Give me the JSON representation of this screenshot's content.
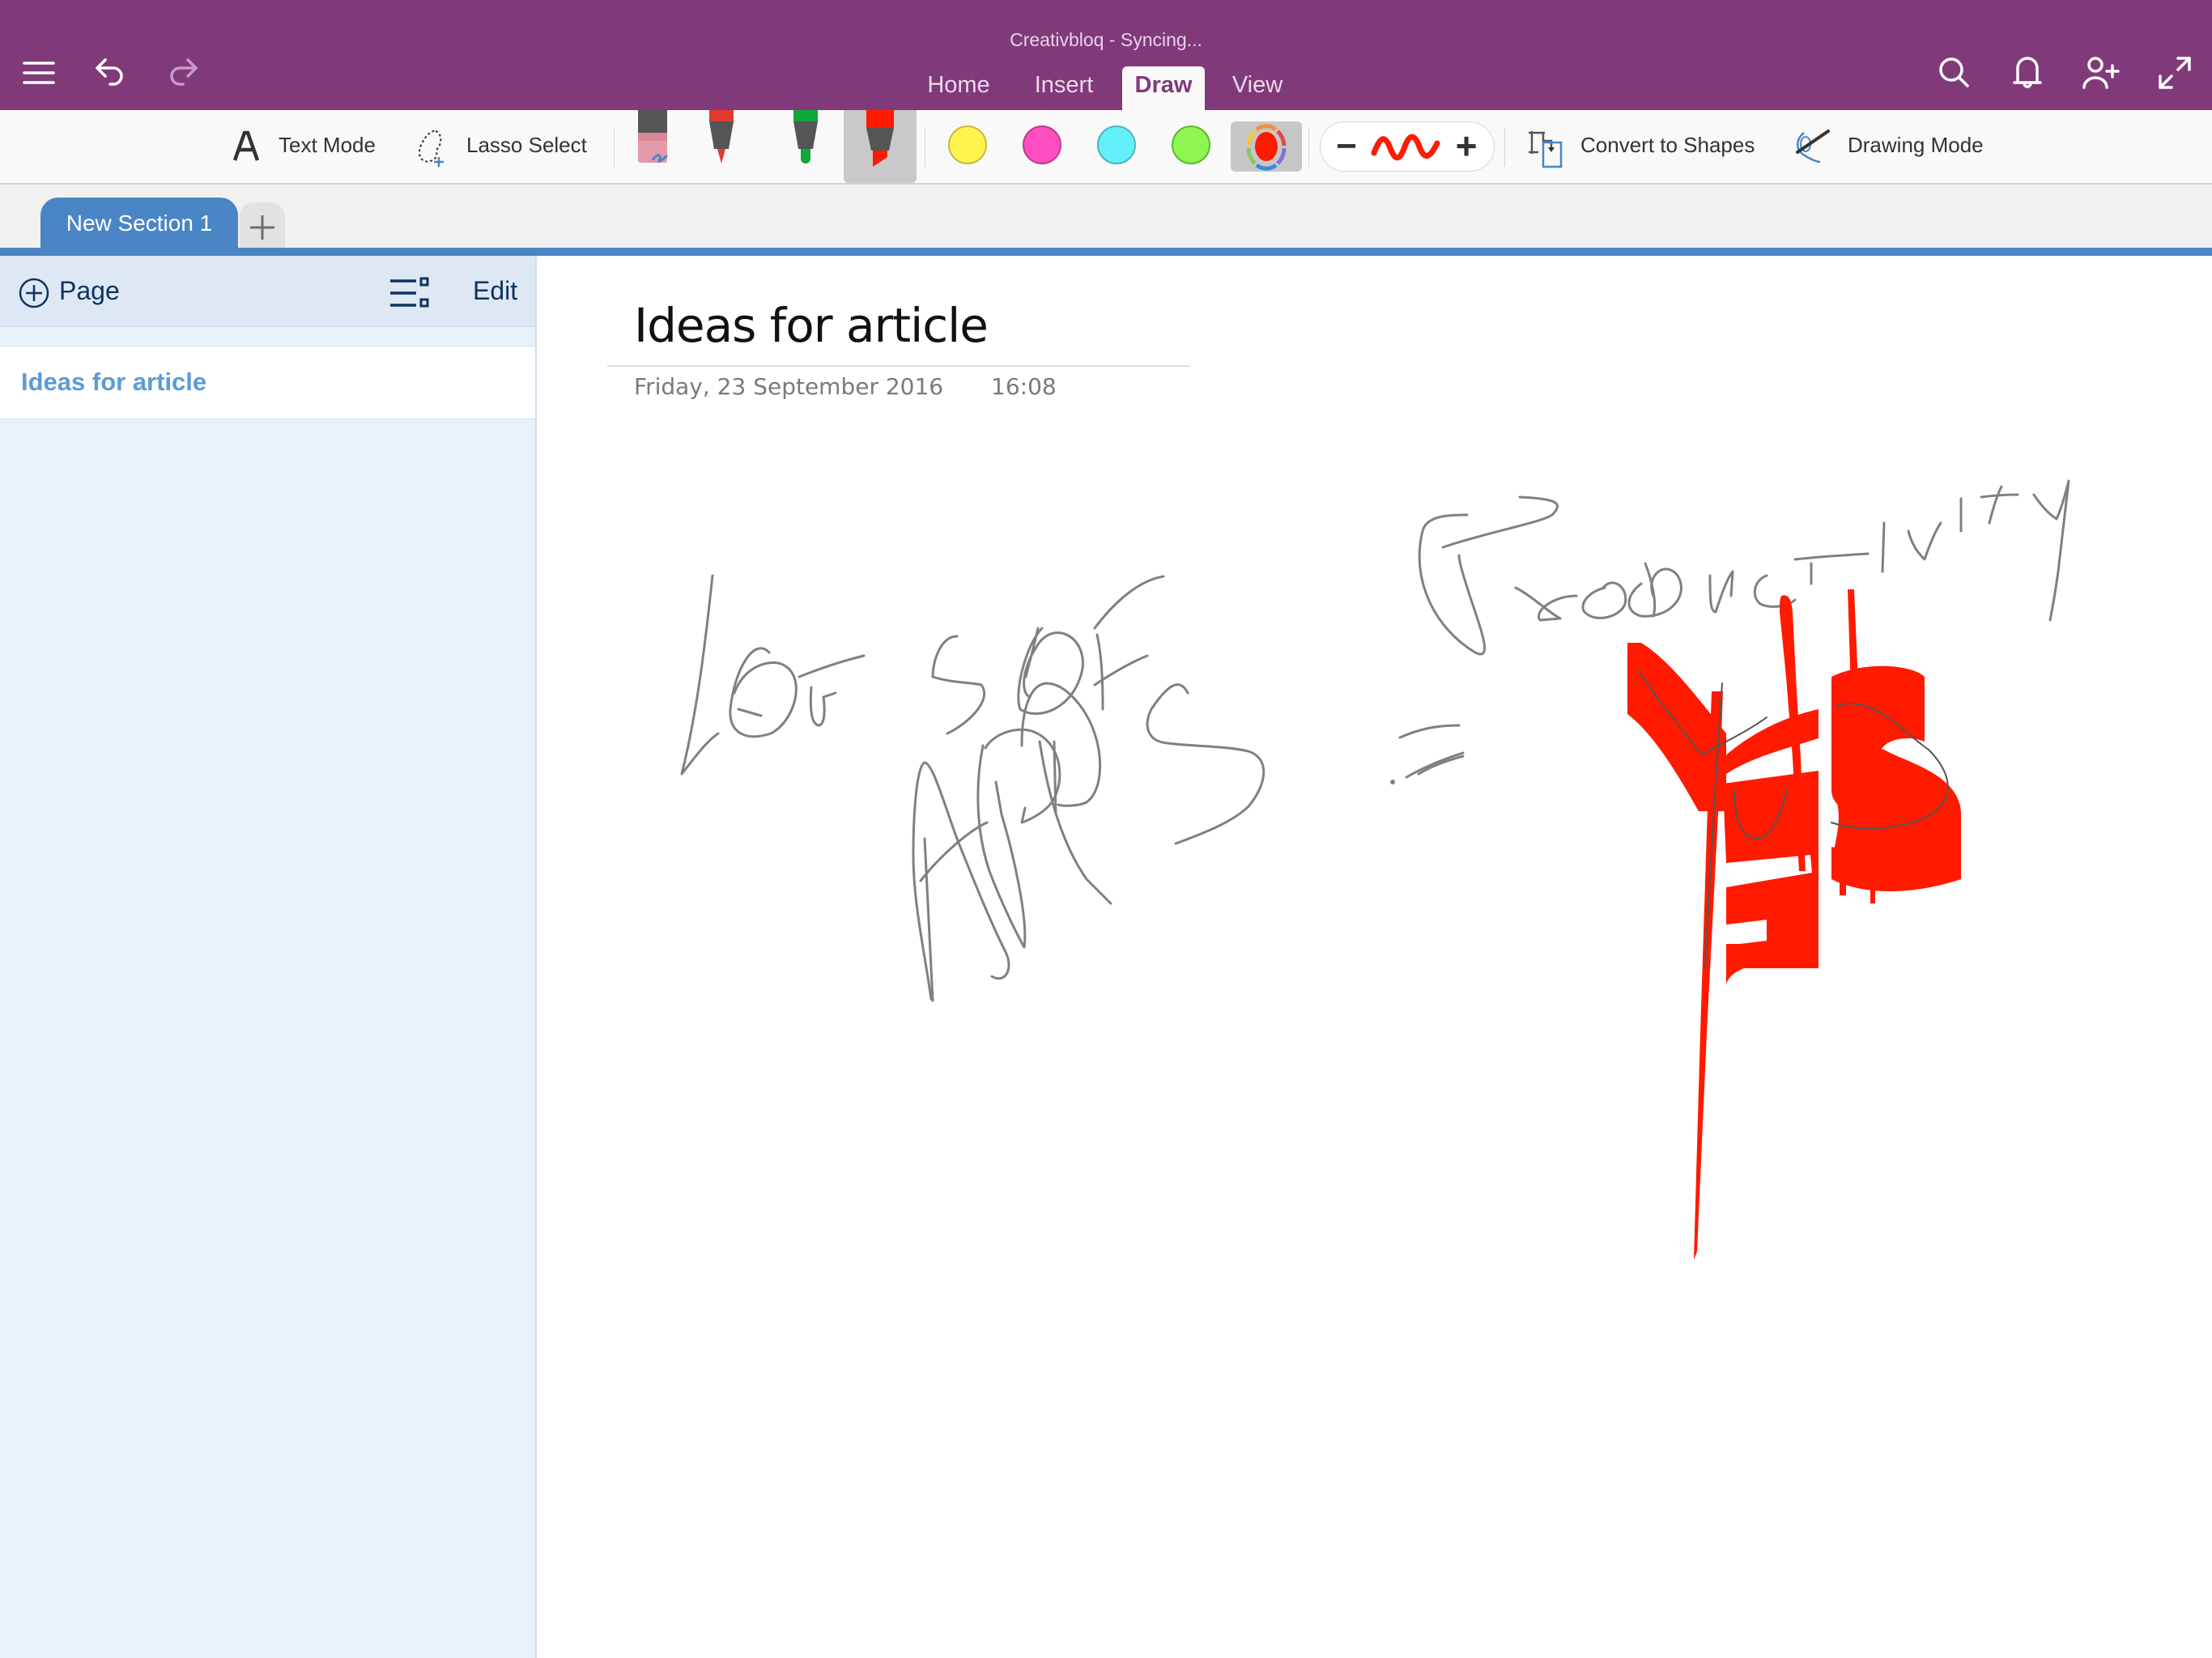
{
  "app": {
    "title": "Creativbloq - Syncing..."
  },
  "header": {
    "left_icons": [
      "hamburger-menu-icon",
      "undo-icon",
      "redo-icon"
    ],
    "right_icons": [
      "search-icon",
      "bell-icon",
      "add-person-icon",
      "expand-icon"
    ],
    "tabs": [
      {
        "label": "Home",
        "active": false
      },
      {
        "label": "Insert",
        "active": false
      },
      {
        "label": "Draw",
        "active": true
      },
      {
        "label": "View",
        "active": false
      }
    ]
  },
  "toolbar": {
    "text_mode_label": "Text Mode",
    "lasso_select_label": "Lasso Select",
    "pens": [
      {
        "name": "eraser",
        "color": "#e49aa8"
      },
      {
        "name": "red-pen",
        "color": "#e33a2e"
      },
      {
        "name": "green-pen",
        "color": "#0fa83b"
      },
      {
        "name": "red-highlighter",
        "color": "#ff1a00",
        "selected": true
      }
    ],
    "colors": [
      {
        "name": "yellow",
        "hex": "#fff44f"
      },
      {
        "name": "magenta",
        "hex": "#ff4ec0"
      },
      {
        "name": "cyan",
        "hex": "#64f0fb"
      },
      {
        "name": "green",
        "hex": "#8ef551"
      },
      {
        "name": "custom-red",
        "hex": "#ff1a00",
        "selected": true
      }
    ],
    "thickness_minus": "−",
    "thickness_plus": "+",
    "convert_to_shapes_label": "Convert to Shapes",
    "drawing_mode_label": "Drawing Mode"
  },
  "sections": {
    "active_tab": "New Section 1",
    "add_label": "+"
  },
  "sidebar": {
    "add_page_label": "Page",
    "edit_label": "Edit",
    "pages": [
      {
        "title": "Ideas for article",
        "selected": true
      }
    ]
  },
  "page": {
    "title": "Ideas for article",
    "date": "Friday, 23 September  2016",
    "time": "16:08",
    "ink_text": [
      "LOTS OF PRODUCTIVITY",
      "APPS =",
      "YES!!"
    ]
  },
  "colors": {
    "header": "#803a7a",
    "section_accent": "#4a86c5",
    "ink_gray": "#808080",
    "ink_red": "#ff1a00"
  }
}
